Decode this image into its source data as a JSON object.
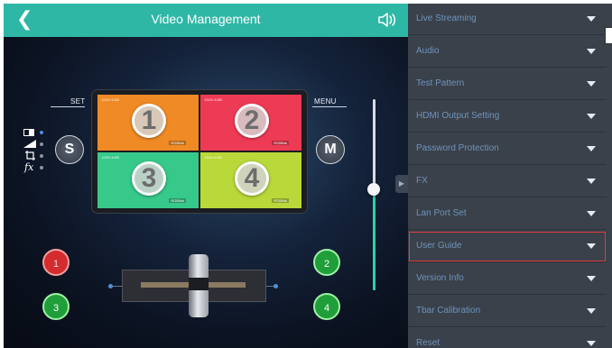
{
  "header": {
    "title": "Video Management",
    "back_icon": "chevron-left-icon",
    "sound_icon": "speaker-icon"
  },
  "labels": {
    "set": "SET",
    "menu": "MENU",
    "s_button": "S",
    "m_button": "M"
  },
  "set_icons": [
    "layout-icon",
    "brightness-ramp-icon",
    "crop-icon",
    "fx-icon"
  ],
  "fx_text": "fx",
  "preview": {
    "quads": [
      {
        "number": "1",
        "resolution": "1920×1080",
        "brand": "RGBlink",
        "color": "#f08a24"
      },
      {
        "number": "2",
        "resolution": "1920×1080",
        "brand": "RGBlink",
        "color": "#ee3b55"
      },
      {
        "number": "3",
        "resolution": "1920×1080",
        "brand": "RGBlink",
        "color": "#37c98a"
      },
      {
        "number": "4",
        "resolution": "1920×1080",
        "brand": "RGBlink",
        "color": "#b9d83a"
      }
    ]
  },
  "sources": {
    "left_top": "1",
    "left_bottom": "3",
    "right_top": "2",
    "right_bottom": "4"
  },
  "volume_level": 0.47,
  "menu": {
    "items": [
      {
        "label": "Live Streaming",
        "highlighted": false
      },
      {
        "label": "Audio",
        "highlighted": false
      },
      {
        "label": "Test Pattern",
        "highlighted": false
      },
      {
        "label": "HDMI Output Setting",
        "highlighted": false
      },
      {
        "label": "Password Protection",
        "highlighted": false
      },
      {
        "label": "FX",
        "highlighted": false
      },
      {
        "label": "Lan Port Set",
        "highlighted": false
      },
      {
        "label": "User Guide",
        "highlighted": true
      },
      {
        "label": "Version Info",
        "highlighted": false
      },
      {
        "label": "Tbar Calibration",
        "highlighted": false
      },
      {
        "label": "Reset",
        "highlighted": false
      }
    ]
  },
  "colors": {
    "accent": "#2fb7a6",
    "panel_bg": "#3a414a",
    "menu_text": "#6f93bd",
    "highlight_border": "#e33b3b"
  }
}
